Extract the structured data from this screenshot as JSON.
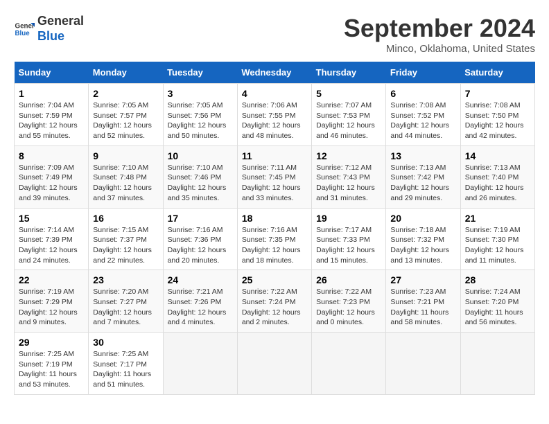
{
  "logo": {
    "line1": "General",
    "line2": "Blue"
  },
  "title": "September 2024",
  "location": "Minco, Oklahoma, United States",
  "days_of_week": [
    "Sunday",
    "Monday",
    "Tuesday",
    "Wednesday",
    "Thursday",
    "Friday",
    "Saturday"
  ],
  "weeks": [
    [
      {
        "day": "1",
        "sunrise": "7:04 AM",
        "sunset": "7:59 PM",
        "daylight": "12 hours and 55 minutes."
      },
      {
        "day": "2",
        "sunrise": "7:05 AM",
        "sunset": "7:57 PM",
        "daylight": "12 hours and 52 minutes."
      },
      {
        "day": "3",
        "sunrise": "7:05 AM",
        "sunset": "7:56 PM",
        "daylight": "12 hours and 50 minutes."
      },
      {
        "day": "4",
        "sunrise": "7:06 AM",
        "sunset": "7:55 PM",
        "daylight": "12 hours and 48 minutes."
      },
      {
        "day": "5",
        "sunrise": "7:07 AM",
        "sunset": "7:53 PM",
        "daylight": "12 hours and 46 minutes."
      },
      {
        "day": "6",
        "sunrise": "7:08 AM",
        "sunset": "7:52 PM",
        "daylight": "12 hours and 44 minutes."
      },
      {
        "day": "7",
        "sunrise": "7:08 AM",
        "sunset": "7:50 PM",
        "daylight": "12 hours and 42 minutes."
      }
    ],
    [
      {
        "day": "8",
        "sunrise": "7:09 AM",
        "sunset": "7:49 PM",
        "daylight": "12 hours and 39 minutes."
      },
      {
        "day": "9",
        "sunrise": "7:10 AM",
        "sunset": "7:48 PM",
        "daylight": "12 hours and 37 minutes."
      },
      {
        "day": "10",
        "sunrise": "7:10 AM",
        "sunset": "7:46 PM",
        "daylight": "12 hours and 35 minutes."
      },
      {
        "day": "11",
        "sunrise": "7:11 AM",
        "sunset": "7:45 PM",
        "daylight": "12 hours and 33 minutes."
      },
      {
        "day": "12",
        "sunrise": "7:12 AM",
        "sunset": "7:43 PM",
        "daylight": "12 hours and 31 minutes."
      },
      {
        "day": "13",
        "sunrise": "7:13 AM",
        "sunset": "7:42 PM",
        "daylight": "12 hours and 29 minutes."
      },
      {
        "day": "14",
        "sunrise": "7:13 AM",
        "sunset": "7:40 PM",
        "daylight": "12 hours and 26 minutes."
      }
    ],
    [
      {
        "day": "15",
        "sunrise": "7:14 AM",
        "sunset": "7:39 PM",
        "daylight": "12 hours and 24 minutes."
      },
      {
        "day": "16",
        "sunrise": "7:15 AM",
        "sunset": "7:37 PM",
        "daylight": "12 hours and 22 minutes."
      },
      {
        "day": "17",
        "sunrise": "7:16 AM",
        "sunset": "7:36 PM",
        "daylight": "12 hours and 20 minutes."
      },
      {
        "day": "18",
        "sunrise": "7:16 AM",
        "sunset": "7:35 PM",
        "daylight": "12 hours and 18 minutes."
      },
      {
        "day": "19",
        "sunrise": "7:17 AM",
        "sunset": "7:33 PM",
        "daylight": "12 hours and 15 minutes."
      },
      {
        "day": "20",
        "sunrise": "7:18 AM",
        "sunset": "7:32 PM",
        "daylight": "12 hours and 13 minutes."
      },
      {
        "day": "21",
        "sunrise": "7:19 AM",
        "sunset": "7:30 PM",
        "daylight": "12 hours and 11 minutes."
      }
    ],
    [
      {
        "day": "22",
        "sunrise": "7:19 AM",
        "sunset": "7:29 PM",
        "daylight": "12 hours and 9 minutes."
      },
      {
        "day": "23",
        "sunrise": "7:20 AM",
        "sunset": "7:27 PM",
        "daylight": "12 hours and 7 minutes."
      },
      {
        "day": "24",
        "sunrise": "7:21 AM",
        "sunset": "7:26 PM",
        "daylight": "12 hours and 4 minutes."
      },
      {
        "day": "25",
        "sunrise": "7:22 AM",
        "sunset": "7:24 PM",
        "daylight": "12 hours and 2 minutes."
      },
      {
        "day": "26",
        "sunrise": "7:22 AM",
        "sunset": "7:23 PM",
        "daylight": "12 hours and 0 minutes."
      },
      {
        "day": "27",
        "sunrise": "7:23 AM",
        "sunset": "7:21 PM",
        "daylight": "11 hours and 58 minutes."
      },
      {
        "day": "28",
        "sunrise": "7:24 AM",
        "sunset": "7:20 PM",
        "daylight": "11 hours and 56 minutes."
      }
    ],
    [
      {
        "day": "29",
        "sunrise": "7:25 AM",
        "sunset": "7:19 PM",
        "daylight": "11 hours and 53 minutes."
      },
      {
        "day": "30",
        "sunrise": "7:25 AM",
        "sunset": "7:17 PM",
        "daylight": "11 hours and 51 minutes."
      },
      null,
      null,
      null,
      null,
      null
    ]
  ]
}
